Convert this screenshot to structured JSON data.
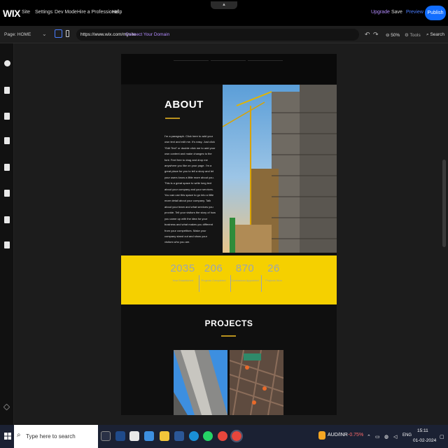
{
  "topbar": {
    "logo": "WIX",
    "menu": [
      "Site",
      "Settings",
      "Dev Mode",
      "Hire a Professional",
      "Help"
    ],
    "upgrade": "Upgrade",
    "save": "Save",
    "preview": "Preview",
    "publish": "Publish",
    "collapse_glyph": "▲"
  },
  "subbar": {
    "page_label": "Page:  HOME",
    "url": "https://www.wix.com/mysite",
    "connect_domain": "Connect Your Domain",
    "zoom": "50%",
    "tools": "Tools",
    "search": "Search"
  },
  "site": {
    "about": {
      "title": "ABOUT",
      "body": "I'm a paragraph. Click here to add your own text and edit me. It's easy. Just click “Edit Text” or double click me to add your own content and make changes to the font. Feel free to drag and drop me anywhere you like on your page. I'm a great place for you to tell a story and let your users know a little more about you. This is a great space to write long text about your company and your services. You can use this space to go into a little more detail about your company. Talk about your team and what services you provide. Tell your visitors the story of how you came up with the idea for your business and what makes you different from your competitors. Make your company stand out and show your visitors who you are."
    },
    "stats": [
      {
        "num": "2035",
        "label": "Year Established"
      },
      {
        "num": "206",
        "label": "Projects Completed"
      },
      {
        "num": "870",
        "label": "Contractors Appointed"
      },
      {
        "num": "26",
        "label": "Projects Won"
      }
    ],
    "projects": {
      "title": "PROJECTS"
    }
  },
  "taskbar": {
    "search_placeholder": "Type here to search",
    "fx_pair": "AUD/INR",
    "fx_change": "-0.75%",
    "lang": "ENG",
    "time": "15:11",
    "date": "01-02-2024"
  },
  "colors": {
    "accent_blue": "#116dff",
    "upgrade_purple": "#b48cff",
    "stats_yellow": "#f5d000",
    "gold_rule": "#b9911e"
  }
}
